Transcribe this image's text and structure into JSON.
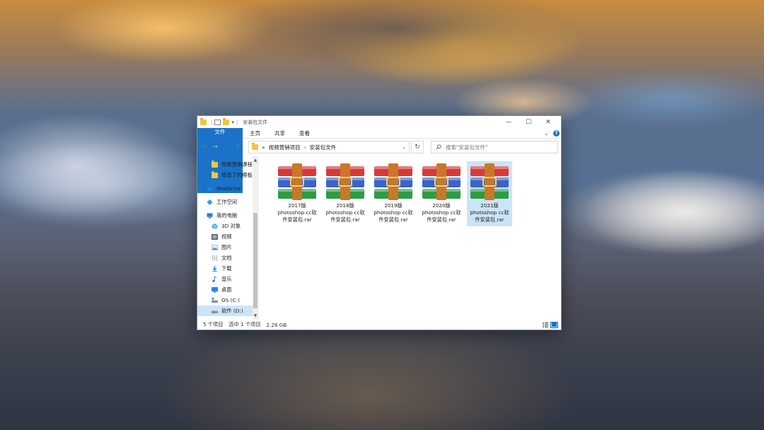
{
  "window": {
    "title": "安装包文件",
    "minimize": "—",
    "maximize": "☐",
    "close": "✕"
  },
  "ribbon": {
    "tabs": [
      "文件",
      "主页",
      "共享",
      "查看"
    ],
    "help": "?",
    "expand": "⌄"
  },
  "nav": {
    "back": "←",
    "forward": "→",
    "recent": "⌄",
    "up": "↑",
    "breadcrumb_prefix": "«",
    "breadcrumb": [
      "视频营销项目",
      "安装包文件"
    ],
    "separator": "›",
    "dropdown": "⌄",
    "refresh": "↻",
    "search_placeholder": "搜索\"安装包文件\""
  },
  "sidebar": {
    "items": [
      {
        "label": "视频营销课程",
        "icon": "folder-icon"
      },
      {
        "label": "修改了的模板",
        "icon": "folder-icon"
      },
      {
        "label": "OneDrive",
        "icon": "cloud-icon"
      },
      {
        "label": "工作空间",
        "icon": "workspace-icon"
      },
      {
        "label": "我的电脑",
        "icon": "computer-icon"
      },
      {
        "label": "3D 对象",
        "icon": "cube-icon"
      },
      {
        "label": "视频",
        "icon": "video-icon"
      },
      {
        "label": "图片",
        "icon": "image-icon"
      },
      {
        "label": "文档",
        "icon": "document-icon"
      },
      {
        "label": "下载",
        "icon": "download-icon"
      },
      {
        "label": "音乐",
        "icon": "music-icon"
      },
      {
        "label": "桌面",
        "icon": "desktop-icon"
      },
      {
        "label": "OS (C:)",
        "icon": "drive-icon"
      },
      {
        "label": "软件 (D:)",
        "icon": "drive-icon"
      }
    ],
    "scroll_up": "▲",
    "scroll_down": "▼"
  },
  "files": [
    {
      "line1": "2017版",
      "line2": "photoshop cc软",
      "line3": "件安装包.rar",
      "icon": "winrar-archive-icon",
      "selected": false
    },
    {
      "line1": "2018版",
      "line2": "photoshop cc软",
      "line3": "件安装包.rar",
      "icon": "winrar-archive-icon",
      "selected": false
    },
    {
      "line1": "2019版",
      "line2": "photoshop cc软",
      "line3": "件安装包.rar",
      "icon": "winrar-archive-icon",
      "selected": false
    },
    {
      "line1": "2020版",
      "line2": "photoshop cc软",
      "line3": "件安装包.rar",
      "icon": "winrar-archive-icon",
      "selected": false
    },
    {
      "line1": "2021版",
      "line2": "photoshop cc软",
      "line3": "件安装包.rar",
      "icon": "winrar-archive-icon",
      "selected": true
    }
  ],
  "status": {
    "count": "5 个项目",
    "selected": "选中 1 个项目",
    "size": "2.26 GB"
  },
  "colors": {
    "accent": "#1a73c8",
    "selection": "#cce4f7",
    "folder": "#f4c542"
  }
}
